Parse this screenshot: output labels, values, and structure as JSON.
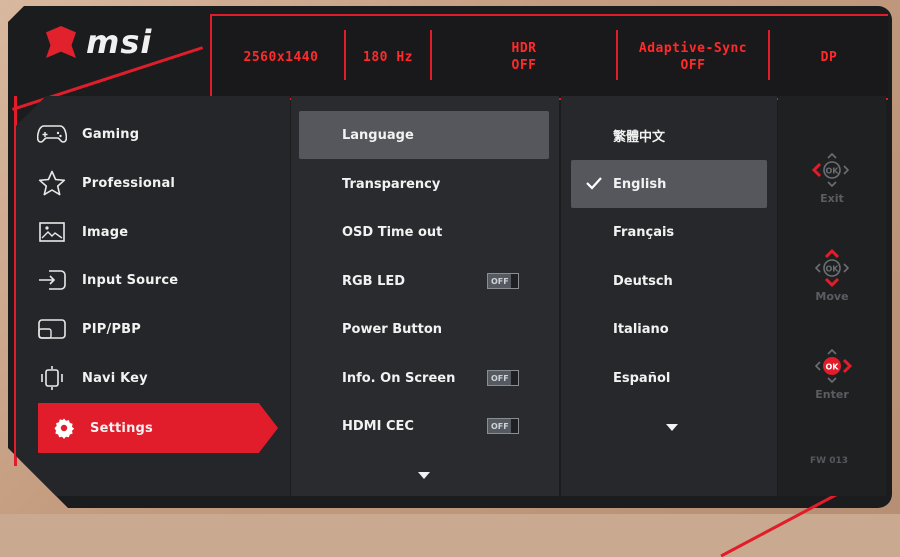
{
  "brand": {
    "logo_text": "msi"
  },
  "status_bar": {
    "resolution": "2560x1440",
    "refresh": "180 Hz",
    "hdr_label": "HDR",
    "hdr_value": "OFF",
    "sync_label": "Adaptive-Sync",
    "sync_value": "OFF",
    "input": "DP"
  },
  "main_menu": {
    "items": [
      {
        "label": "Gaming",
        "icon": "gamepad-icon"
      },
      {
        "label": "Professional",
        "icon": "star-icon"
      },
      {
        "label": "Image",
        "icon": "image-icon"
      },
      {
        "label": "Input Source",
        "icon": "input-source-icon"
      },
      {
        "label": "PIP/PBP",
        "icon": "pip-icon"
      },
      {
        "label": "Navi Key",
        "icon": "navi-key-icon"
      },
      {
        "label": "Settings",
        "icon": "gear-icon",
        "active": true
      }
    ]
  },
  "settings_menu": {
    "items": [
      {
        "label": "Language",
        "selected": true
      },
      {
        "label": "Transparency"
      },
      {
        "label": "OSD Time out"
      },
      {
        "label": "RGB LED",
        "toggle": "OFF"
      },
      {
        "label": "Power Button"
      },
      {
        "label": "Info. On Screen",
        "toggle": "OFF"
      },
      {
        "label": "HDMI CEC",
        "toggle": "OFF"
      }
    ]
  },
  "language_menu": {
    "items": [
      {
        "label": "繁體中文"
      },
      {
        "label": "English",
        "selected": true
      },
      {
        "label": "Français"
      },
      {
        "label": "Deutsch"
      },
      {
        "label": "Italiano"
      },
      {
        "label": "Español"
      }
    ]
  },
  "keys": {
    "exit_label": "Exit",
    "move_label": "Move",
    "enter_label": "Enter",
    "ok_text": "OK",
    "firmware": "FW 013"
  },
  "colors": {
    "accent_red": "#e11d2b",
    "panel_dark": "#252629",
    "selection_grey": "#55575c"
  }
}
